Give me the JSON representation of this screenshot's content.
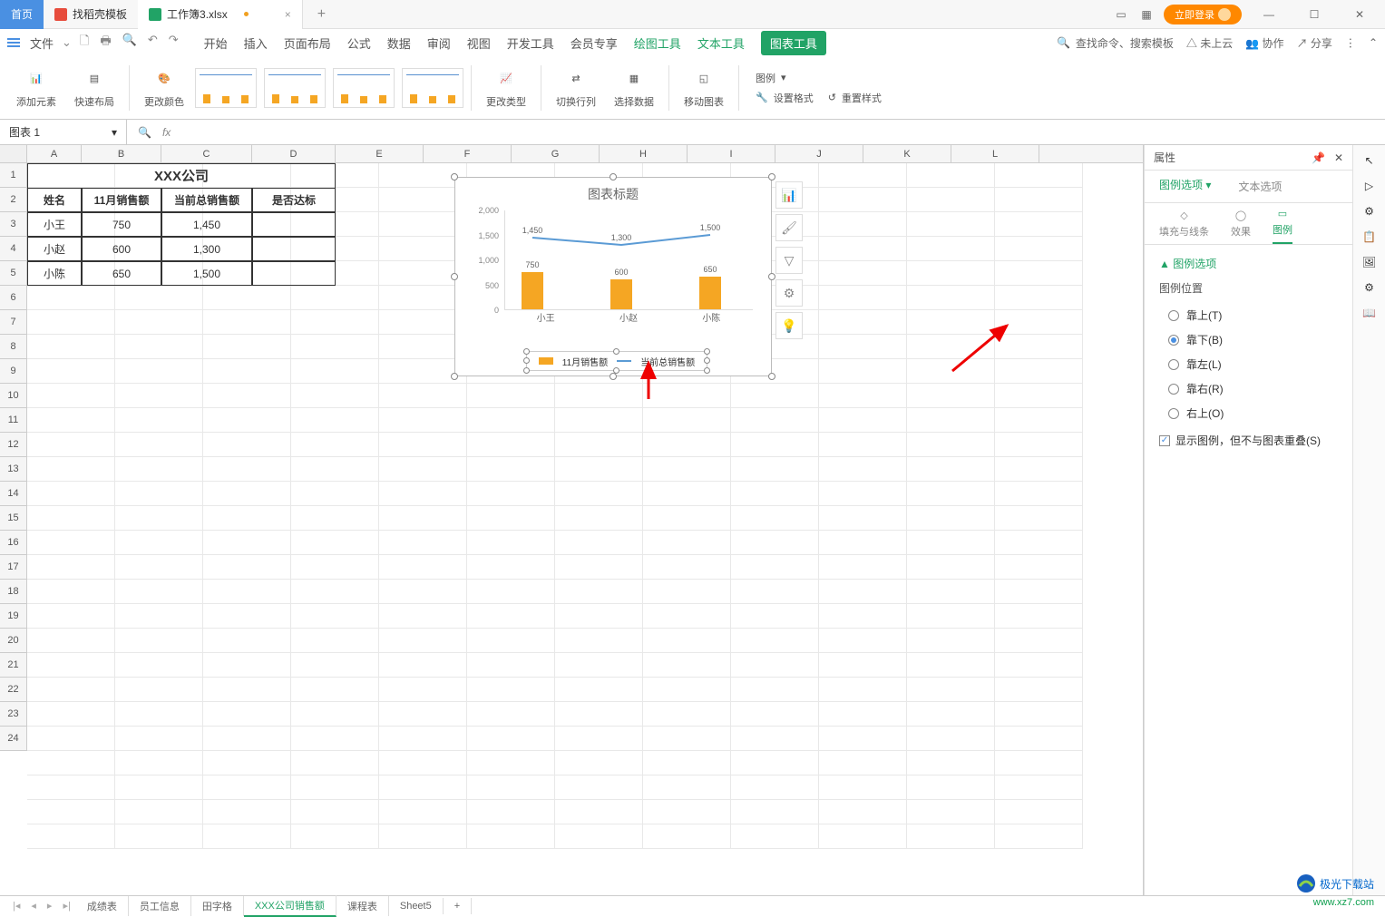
{
  "titlebar": {
    "home": "首页",
    "template": "找稻壳模板",
    "doc": "工作簿3.xlsx",
    "add": "+",
    "login": "立即登录"
  },
  "menubar": {
    "file": "文件",
    "tabs": [
      "开始",
      "插入",
      "页面布局",
      "公式",
      "数据",
      "审阅",
      "视图",
      "开发工具",
      "会员专享",
      "绘图工具",
      "文本工具",
      "图表工具"
    ],
    "search_cmd": "查找命令、搜索模板",
    "cloud": "未上云",
    "collab": "协作",
    "share": "分享"
  },
  "ribbon": {
    "add_element": "添加元素",
    "quick_layout": "快速布局",
    "change_color": "更改颜色",
    "change_type": "更改类型",
    "switch_rowcol": "切换行列",
    "select_data": "选择数据",
    "move_chart": "移动图表",
    "legend": "图例",
    "set_format": "设置格式",
    "reset_style": "重置样式"
  },
  "namebox": "图表 1",
  "fx": "fx",
  "columns": [
    "A",
    "B",
    "C",
    "D",
    "E",
    "F",
    "G",
    "H",
    "I",
    "J",
    "K",
    "L"
  ],
  "rows": [
    "1",
    "2",
    "3",
    "4",
    "5",
    "6",
    "7",
    "8",
    "9",
    "10",
    "11",
    "12",
    "13",
    "14",
    "15",
    "16",
    "17",
    "18",
    "19",
    "20",
    "21",
    "22",
    "23",
    "24"
  ],
  "table": {
    "title": "XXX公司",
    "headers": [
      "姓名",
      "11月销售额",
      "当前总销售额",
      "是否达标"
    ],
    "rows": [
      [
        "小王",
        "750",
        "1,450",
        ""
      ],
      [
        "小赵",
        "600",
        "1,300",
        ""
      ],
      [
        "小陈",
        "650",
        "1,500",
        ""
      ]
    ]
  },
  "chart_data": {
    "type": "combo",
    "title": "图表标题",
    "categories": [
      "小王",
      "小赵",
      "小陈"
    ],
    "series": [
      {
        "name": "11月销售额",
        "type": "bar",
        "values": [
          750,
          600,
          650
        ]
      },
      {
        "name": "当前总销售额",
        "type": "line",
        "values": [
          1450,
          1300,
          1500
        ]
      }
    ],
    "y_ticks": [
      "2,000",
      "1,500",
      "1,000",
      "500",
      "0"
    ],
    "ylim": [
      0,
      2000
    ],
    "legend_position": "bottom"
  },
  "panel": {
    "title": "属性",
    "tab1": "图例选项",
    "tab2": "文本选项",
    "sub_fill": "填充与线条",
    "sub_effect": "效果",
    "sub_legend": "图例",
    "section": "▲ 图例选项",
    "pos_label": "图例位置",
    "opt_top": "靠上(T)",
    "opt_bottom": "靠下(B)",
    "opt_left": "靠左(L)",
    "opt_right": "靠右(R)",
    "opt_topright": "右上(O)",
    "overlap": "显示图例，但不与图表重叠(S)"
  },
  "sheets": {
    "tabs": [
      "成绩表",
      "员工信息",
      "田字格",
      "XXX公司销售额",
      "课程表",
      "Sheet5"
    ],
    "add": "+"
  },
  "watermark": "极光下载站",
  "wmurl": "www.xz7.com"
}
